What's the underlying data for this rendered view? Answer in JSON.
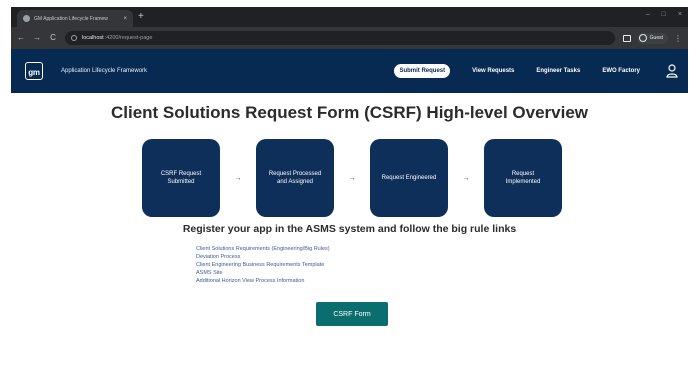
{
  "browser": {
    "tab_title": "GM Application Lifecycle Framew",
    "tab_close": "×",
    "new_tab": "+",
    "url_host": "localhost",
    "url_path": ":4200/request-page",
    "guest_label": "Guest",
    "back": "←",
    "forward": "→",
    "reload": "C",
    "menu": "⋮",
    "minimize": "–",
    "maximize": "□",
    "close": "×"
  },
  "appnav": {
    "logo_text": "gm",
    "app_title": "Application Lifecycle Framework",
    "links": [
      "Submit Request",
      "View Requests",
      "Engineer Tasks",
      "EWO Factory"
    ],
    "active_link": "Submit Request",
    "user_icon": "user-icon"
  },
  "main": {
    "title": "Client Solutions Request Form (CSRF) High-level Overview",
    "steps": [
      "CSRF Request Submitted",
      "Request Processed and Assigned",
      "Request Engineered",
      "Request Implemented"
    ],
    "arrow": "→",
    "subheading": "Register your app in the ASMS system and follow the big rule links",
    "links": [
      "Client Solutions Requirements (Engineering/Big Rules)",
      "Deviation Process",
      "Client Engineering Business Requirements Template",
      "ASMS Site",
      "Additional Horizon View Process Information"
    ],
    "button_label": "CSRF Form"
  },
  "colors": {
    "nav_bg": "#072a52",
    "step_bg": "#0d2f5a",
    "button_bg": "#0b6e6e",
    "link": "#3d5a9a"
  }
}
